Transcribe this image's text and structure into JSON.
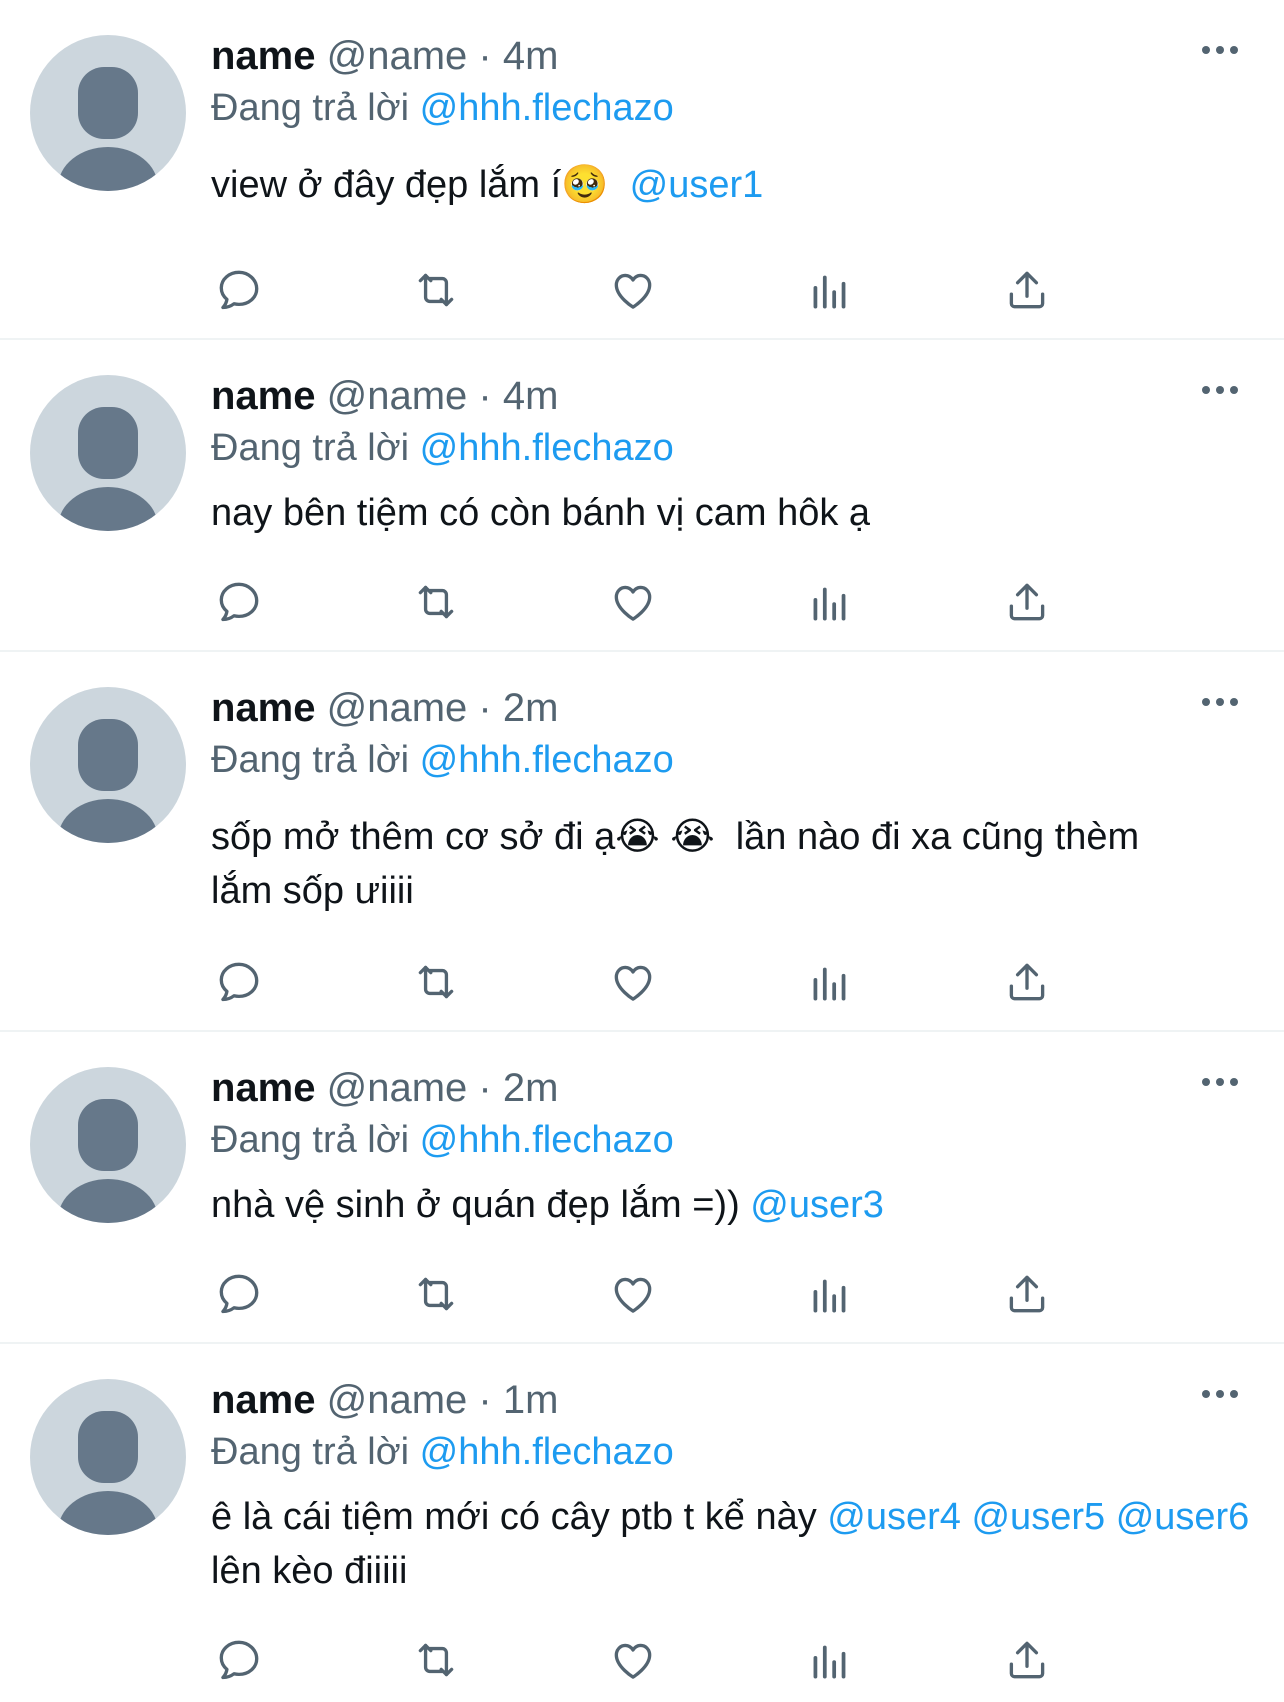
{
  "colors": {
    "text": "#0f1419",
    "secondary": "#536471",
    "link": "#1d9bf0",
    "avatar_bg": "#ccd6dd",
    "avatar_fg": "#66788a",
    "divider": "#eff3f4"
  },
  "icons": [
    "more-icon",
    "reply-icon",
    "retweet-icon",
    "like-icon",
    "views-icon",
    "share-icon"
  ],
  "tweets": [
    {
      "name": "name",
      "handle": "@name",
      "sep": "·",
      "time": "4m",
      "reply_prefix": "Đang trả lời",
      "reply_to": "@hhh.flechazo",
      "text1": "view ở đây đẹp lắm í",
      "emoji": "🥹",
      "mention1": "@user1"
    },
    {
      "name": "name",
      "handle": "@name",
      "sep": "·",
      "time": "4m",
      "reply_prefix": "Đang trả lời",
      "reply_to": "@hhh.flechazo",
      "text1": "nay bên tiệm có còn bánh vị cam hôk ạ"
    },
    {
      "name": "name",
      "handle": "@name",
      "sep": "·",
      "time": "2m",
      "reply_prefix": "Đang trả lời",
      "reply_to": "@hhh.flechazo",
      "text1": "sốp mở thêm cơ sở đi ạ",
      "emoji": "😭",
      "emoji2": "😭",
      "text2": "lần nào đi xa cũng thèm lắm sốp ưiiii"
    },
    {
      "name": "name",
      "handle": "@name",
      "sep": "·",
      "time": "2m",
      "reply_prefix": "Đang trả lời",
      "reply_to": "@hhh.flechazo",
      "text1": "nhà vệ sinh ở quán đẹp lắm =))",
      "mention1": "@user3"
    },
    {
      "name": "name",
      "handle": "@name",
      "sep": "·",
      "time": "1m",
      "reply_prefix": "Đang trả lời",
      "reply_to": "@hhh.flechazo",
      "text1": "ê là cái tiệm mới có cây ptb t kể này",
      "mention1": "@user4",
      "mention2": "@user5",
      "mention3": "@user6",
      "text2": "lên kèo điiiii"
    }
  ]
}
